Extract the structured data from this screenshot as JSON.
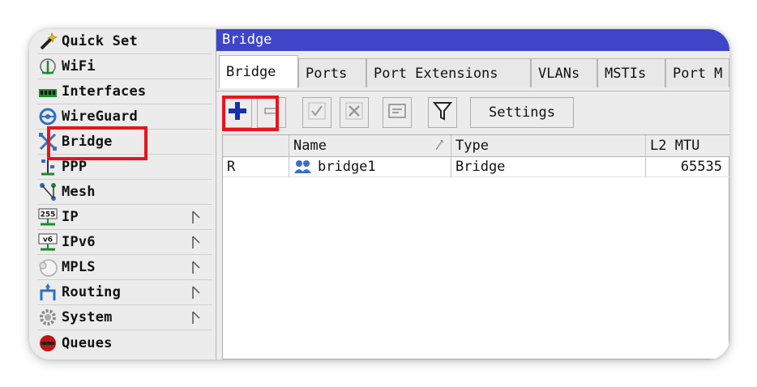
{
  "sidebar": {
    "items": [
      {
        "label": "Quick Set",
        "icon": "wand-icon",
        "has_submenu": false
      },
      {
        "label": "WiFi",
        "icon": "antenna-icon",
        "has_submenu": false
      },
      {
        "label": "Interfaces",
        "icon": "interfaces-icon",
        "has_submenu": false
      },
      {
        "label": "WireGuard",
        "icon": "wireguard-icon",
        "has_submenu": false
      },
      {
        "label": "Bridge",
        "icon": "bridge-icon",
        "has_submenu": false
      },
      {
        "label": "PPP",
        "icon": "ppp-icon",
        "has_submenu": false
      },
      {
        "label": "Mesh",
        "icon": "mesh-icon",
        "has_submenu": false
      },
      {
        "label": "IP",
        "icon": "ip-icon",
        "icon_text": "255",
        "has_submenu": true
      },
      {
        "label": "IPv6",
        "icon": "ipv6-icon",
        "icon_text": "v6",
        "has_submenu": true
      },
      {
        "label": "MPLS",
        "icon": "mpls-icon",
        "has_submenu": true
      },
      {
        "label": "Routing",
        "icon": "routing-icon",
        "has_submenu": true
      },
      {
        "label": "System",
        "icon": "gear-icon",
        "has_submenu": true
      },
      {
        "label": "Queues",
        "icon": "queues-icon",
        "has_submenu": false
      }
    ]
  },
  "window": {
    "title": "Bridge",
    "title_bar_color": "#3f45c9",
    "tabs": [
      {
        "label": "Bridge",
        "active": true
      },
      {
        "label": "Ports",
        "active": false
      },
      {
        "label": "Port Extensions",
        "active": false
      },
      {
        "label": "VLANs",
        "active": false
      },
      {
        "label": "MSTIs",
        "active": false
      },
      {
        "label": "Port M",
        "active": false
      }
    ],
    "toolbar": {
      "add_icon": "plus-icon",
      "remove_icon": "minus-icon",
      "enable_icon": "check-icon",
      "disable_icon": "x-icon",
      "comment_icon": "comment-icon",
      "filter_icon": "filter-icon",
      "settings_label": "Settings"
    },
    "table": {
      "columns": [
        "",
        "Name",
        "Type",
        "L2 MTU"
      ],
      "rows": [
        {
          "flag": "R",
          "name": "bridge1",
          "type": "Bridge",
          "l2_mtu": "65535"
        }
      ]
    }
  },
  "highlight_color": "#e8151b"
}
